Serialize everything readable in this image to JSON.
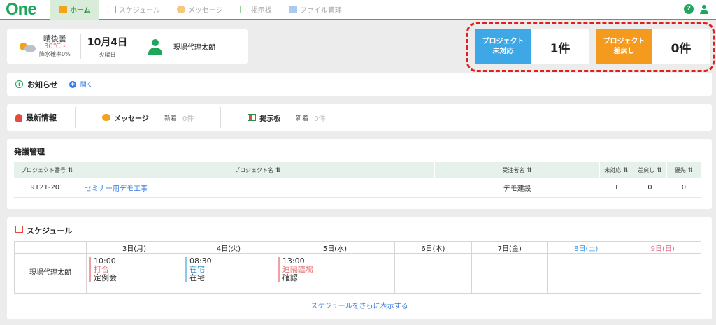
{
  "app": {
    "logo": "One"
  },
  "nav": [
    {
      "label": "ホーム",
      "active": true,
      "icon": "home-icon"
    },
    {
      "label": "スケジュール",
      "active": false,
      "icon": "calendar-icon"
    },
    {
      "label": "メッセージ",
      "active": false,
      "icon": "message-icon"
    },
    {
      "label": "掲示板",
      "active": false,
      "icon": "board-icon"
    },
    {
      "label": "ファイル管理",
      "active": false,
      "icon": "file-icon"
    }
  ],
  "header_right": {
    "help": "?"
  },
  "info": {
    "weather": "晴後曇",
    "temp": "30℃ -",
    "rain": "降水確率0%",
    "date": "10月4日",
    "weekday": "火曜日",
    "user": "現場代理太朗"
  },
  "project_cards": [
    {
      "label_line1": "プロジェクト",
      "label_line2": "未対応",
      "count": "1件",
      "color": "#3ea7e6"
    },
    {
      "label_line1": "プロジェクト",
      "label_line2": "差戻し",
      "count": "0件",
      "color": "#f39a1f"
    }
  ],
  "notice": {
    "title": "お知らせ",
    "open": "開く"
  },
  "latest": {
    "title": "最新情報",
    "message_label": "メッセージ",
    "board_label": "掲示板",
    "new_label": "新着",
    "message_count": "0件",
    "board_count": "0件"
  },
  "orders": {
    "title": "発議管理",
    "columns": [
      "プロジェクト番号",
      "プロジェクト名",
      "受注者名",
      "未対応",
      "差戻し",
      "優先"
    ],
    "rows": [
      {
        "number": "9121-201",
        "name": "セミナー用デモ工事",
        "contractor": "デモ建設",
        "pending": "1",
        "returned": "0",
        "priority": "0"
      }
    ]
  },
  "schedule": {
    "title": "スケジュール",
    "days": [
      {
        "label": "3日(月)",
        "color": "#222"
      },
      {
        "label": "4日(火)",
        "color": "#222"
      },
      {
        "label": "5日(水)",
        "color": "#222"
      },
      {
        "label": "6日(木)",
        "color": "#222"
      },
      {
        "label": "7日(金)",
        "color": "#222"
      },
      {
        "label": "8日(土)",
        "color": "#3a96e0"
      },
      {
        "label": "9日(日)",
        "color": "#e06a8a"
      }
    ],
    "person": "現場代理太朗",
    "events": [
      {
        "time": "10:00",
        "name": "打合",
        "detail": "定例会",
        "style": "pink"
      },
      {
        "time": "08:30",
        "name": "在宅",
        "detail": "在宅",
        "style": "blue"
      },
      {
        "time": "13:00",
        "name": "遠隔臨場",
        "detail": "確認",
        "style": "pink"
      }
    ],
    "more": "スケジュールをさらに表示する"
  }
}
